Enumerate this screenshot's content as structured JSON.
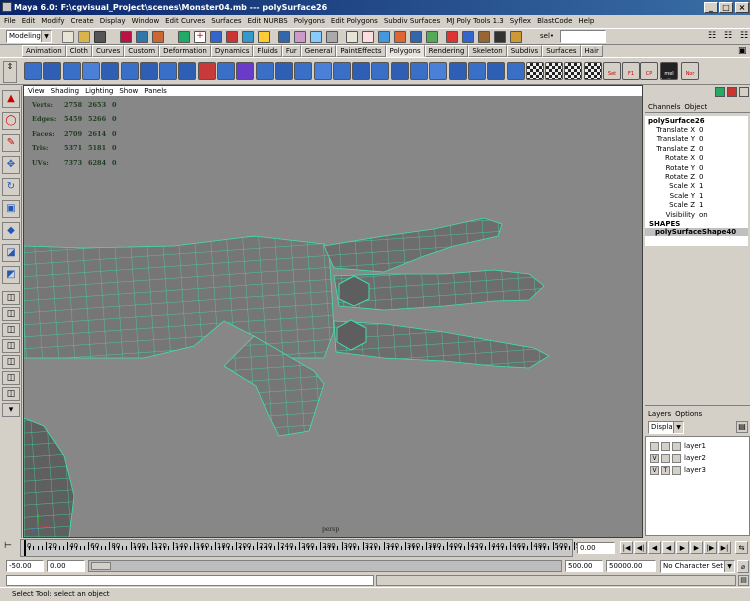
{
  "window": {
    "title": "Maya 6.0: F:\\cgvisual_Project\\scenes\\Monster04.mb   ---   polySurface26",
    "buttons": [
      "_",
      "□",
      "×"
    ]
  },
  "menubar": [
    "File",
    "Edit",
    "Modify",
    "Create",
    "Display",
    "Window",
    "Edit Curves",
    "Surfaces",
    "Edit NURBS",
    "Polygons",
    "Edit Polygons",
    "Subdiv Surfaces",
    "MJ Poly Tools 1.3",
    "Syflex",
    "BlastCode",
    "Help"
  ],
  "statusline": {
    "menuset": "Modeling",
    "sel_field_label": "sel•",
    "sel_field_value": ""
  },
  "shelf_tabs": [
    "Animation",
    "Cloth",
    "Curves",
    "Custom",
    "Deformation",
    "Dynamics",
    "Fluids",
    "Fur",
    "General",
    "PaintEffects",
    "Polygons",
    "Rendering",
    "Skeleton",
    "Subdivs",
    "Surfaces",
    "Hair"
  ],
  "shelf_active_tab": "Polygons",
  "shelf_text_buttons": [
    "Set",
    "F1",
    "CP",
    "mel button",
    "Nor"
  ],
  "viewport": {
    "menu": [
      "View",
      "Shading",
      "Lighting",
      "Show",
      "Panels"
    ],
    "camera": "persp",
    "hud": [
      {
        "label": "Verts:",
        "v1": "2758",
        "v2": "2653",
        "v3": "0"
      },
      {
        "label": "Edges:",
        "v1": "5459",
        "v2": "5266",
        "v3": "0"
      },
      {
        "label": "Faces:",
        "v1": "2709",
        "v2": "2614",
        "v3": "0"
      },
      {
        "label": "Tris:",
        "v1": "5371",
        "v2": "5181",
        "v3": "0"
      },
      {
        "label": "UVs:",
        "v1": "7373",
        "v2": "6284",
        "v3": "0"
      }
    ],
    "colors": {
      "background": "#878787",
      "mesh_fill": "#767676",
      "wire": "#3fe0b0"
    }
  },
  "channelbox": {
    "tabs": [
      "Channels",
      "Object"
    ],
    "object_name": "polySurface26",
    "attributes": [
      {
        "name": "Translate X",
        "value": "0"
      },
      {
        "name": "Translate Y",
        "value": "0"
      },
      {
        "name": "Translate Z",
        "value": "0"
      },
      {
        "name": "Rotate X",
        "value": "0"
      },
      {
        "name": "Rotate Y",
        "value": "0"
      },
      {
        "name": "Rotate Z",
        "value": "0"
      },
      {
        "name": "Scale X",
        "value": "1"
      },
      {
        "name": "Scale Y",
        "value": "1"
      },
      {
        "name": "Scale Z",
        "value": "1"
      },
      {
        "name": "Visibility",
        "value": "on"
      }
    ],
    "shapes_label": "SHAPES",
    "shape_name": "polySurfaceShape40"
  },
  "layers": {
    "tabs": [
      "Layers",
      "Options"
    ],
    "display_select": "Display",
    "rows": [
      {
        "v": "",
        "t": "",
        "name": "layer1"
      },
      {
        "v": "V",
        "t": "",
        "name": "layer2"
      },
      {
        "v": "V",
        "t": "T",
        "name": "layer3"
      }
    ]
  },
  "timeline": {
    "ticks": [
      "0",
      "20",
      "40",
      "60",
      "80",
      "100",
      "120",
      "140",
      "160",
      "180",
      "200",
      "220",
      "240",
      "260",
      "280",
      "300",
      "320",
      "340",
      "360",
      "380",
      "400",
      "420",
      "440",
      "460",
      "480",
      "500",
      "5"
    ],
    "current_time": "0.00"
  },
  "range": {
    "start_anim": "-50.00",
    "start_playback": "0.00",
    "end_playback": "500.00",
    "end_anim": "50000.00",
    "character_set": "No Character Set"
  },
  "help_line": "Select Tool: select an object"
}
